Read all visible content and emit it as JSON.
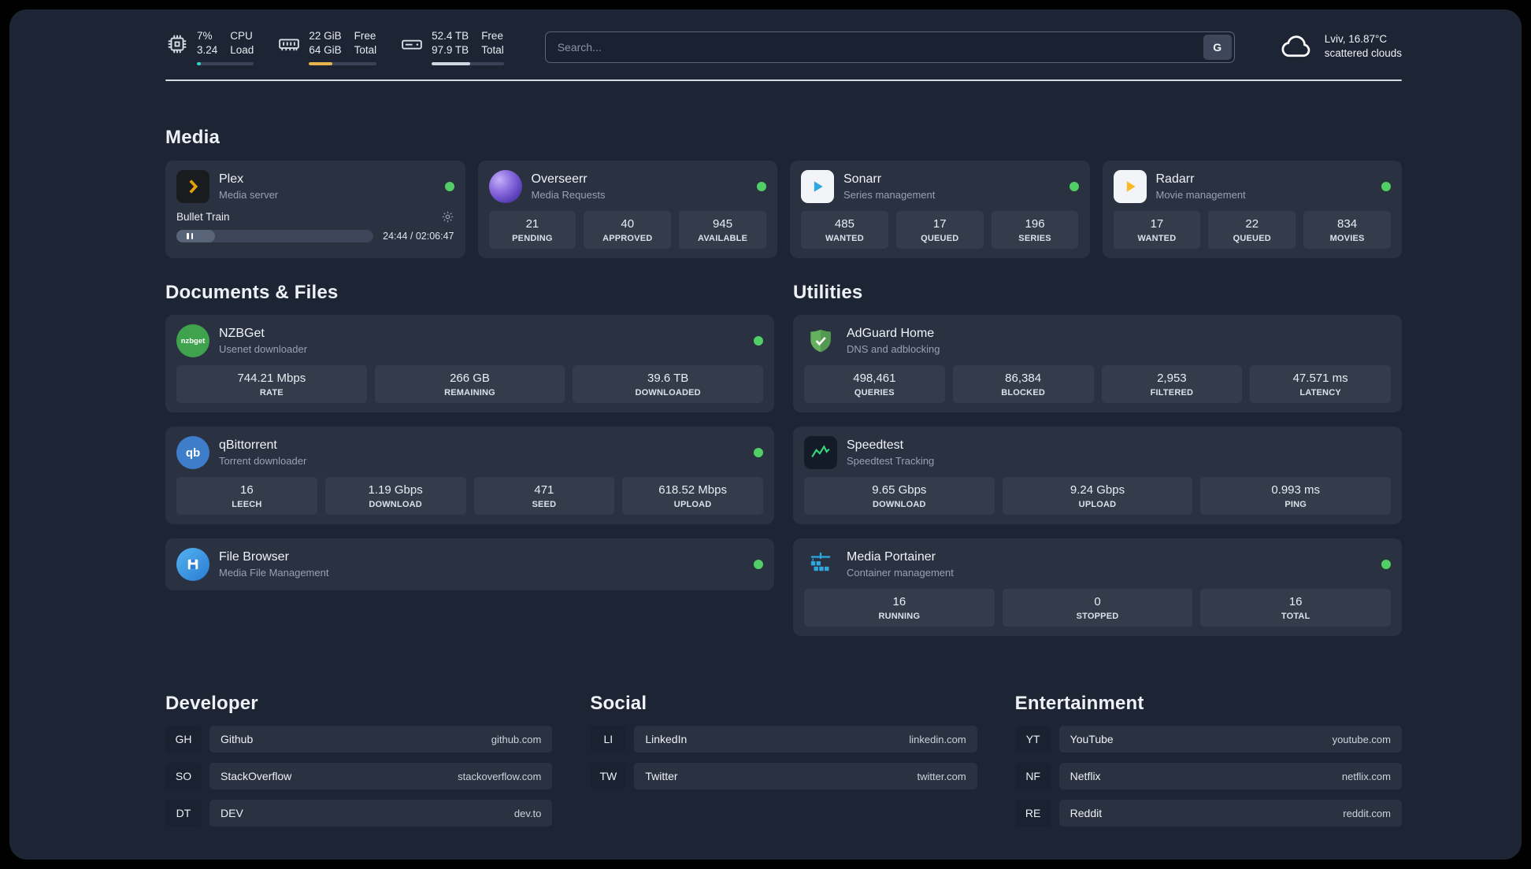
{
  "colors": {
    "status_online": "#51cf66",
    "cpu_fill": "#2fd6c3",
    "ram_fill": "#e8b44c",
    "disk_fill": "#cfd6e0"
  },
  "topbar": {
    "cpu": {
      "value_top": "7%",
      "value_bottom": "3.24",
      "label_top": "CPU",
      "label_bottom": "Load",
      "fill_percent": 7
    },
    "ram": {
      "value_top": "22 GiB",
      "value_bottom": "64 GiB",
      "label_top": "Free",
      "label_bottom": "Total",
      "fill_percent": 34
    },
    "disk": {
      "value_top": "52.4 TB",
      "value_bottom": "97.9 TB",
      "label_top": "Free",
      "label_bottom": "Total",
      "fill_percent": 53
    },
    "search": {
      "placeholder": "Search...",
      "engine_label": "G"
    },
    "weather": {
      "location": "Lviv, 16.87°C",
      "condition": "scattered clouds"
    }
  },
  "sections": {
    "media": {
      "title": "Media",
      "cards": [
        {
          "name": "Plex",
          "desc": "Media server",
          "status": "online",
          "player": {
            "track": "Bullet Train",
            "time": "24:44 / 02:06:47",
            "progress_percent": 19.5
          }
        },
        {
          "name": "Overseerr",
          "desc": "Media Requests",
          "status": "online",
          "stats": [
            {
              "value": "21",
              "label": "PENDING"
            },
            {
              "value": "40",
              "label": "APPROVED"
            },
            {
              "value": "945",
              "label": "AVAILABLE"
            }
          ]
        },
        {
          "name": "Sonarr",
          "desc": "Series management",
          "status": "online",
          "stats": [
            {
              "value": "485",
              "label": "WANTED"
            },
            {
              "value": "17",
              "label": "QUEUED"
            },
            {
              "value": "196",
              "label": "SERIES"
            }
          ]
        },
        {
          "name": "Radarr",
          "desc": "Movie management",
          "status": "online",
          "stats": [
            {
              "value": "17",
              "label": "WANTED"
            },
            {
              "value": "22",
              "label": "QUEUED"
            },
            {
              "value": "834",
              "label": "MOVIES"
            }
          ]
        }
      ]
    },
    "documents": {
      "title": "Documents & Files",
      "cards": [
        {
          "name": "NZBGet",
          "desc": "Usenet downloader",
          "status": "online",
          "icon_text": "nzbget",
          "stats": [
            {
              "value": "744.21 Mbps",
              "label": "RATE"
            },
            {
              "value": "266 GB",
              "label": "REMAINING"
            },
            {
              "value": "39.6 TB",
              "label": "DOWNLOADED"
            }
          ]
        },
        {
          "name": "qBittorrent",
          "desc": "Torrent downloader",
          "status": "online",
          "icon_text": "qb",
          "stats": [
            {
              "value": "16",
              "label": "LEECH"
            },
            {
              "value": "1.19 Gbps",
              "label": "DOWNLOAD"
            },
            {
              "value": "471",
              "label": "SEED"
            },
            {
              "value": "618.52 Mbps",
              "label": "UPLOAD"
            }
          ]
        },
        {
          "name": "File Browser",
          "desc": "Media File Management",
          "status": "online"
        }
      ]
    },
    "utilities": {
      "title": "Utilities",
      "cards": [
        {
          "name": "AdGuard Home",
          "desc": "DNS and adblocking",
          "stats": [
            {
              "value": "498,461",
              "label": "QUERIES"
            },
            {
              "value": "86,384",
              "label": "BLOCKED"
            },
            {
              "value": "2,953",
              "label": "FILTERED"
            },
            {
              "value": "47.571 ms",
              "label": "LATENCY"
            }
          ]
        },
        {
          "name": "Speedtest",
          "desc": "Speedtest Tracking",
          "stats": [
            {
              "value": "9.65 Gbps",
              "label": "DOWNLOAD"
            },
            {
              "value": "9.24 Gbps",
              "label": "UPLOAD"
            },
            {
              "value": "0.993 ms",
              "label": "PING"
            }
          ]
        },
        {
          "name": "Media Portainer",
          "desc": "Container management",
          "status": "online",
          "stats": [
            {
              "value": "16",
              "label": "RUNNING"
            },
            {
              "value": "0",
              "label": "STOPPED"
            },
            {
              "value": "16",
              "label": "TOTAL"
            }
          ]
        }
      ]
    },
    "developer": {
      "title": "Developer",
      "bookmarks": [
        {
          "abbr": "GH",
          "name": "Github",
          "url": "github.com"
        },
        {
          "abbr": "SO",
          "name": "StackOverflow",
          "url": "stackoverflow.com"
        },
        {
          "abbr": "DT",
          "name": "DEV",
          "url": "dev.to"
        }
      ]
    },
    "social": {
      "title": "Social",
      "bookmarks": [
        {
          "abbr": "LI",
          "name": "LinkedIn",
          "url": "linkedin.com"
        },
        {
          "abbr": "TW",
          "name": "Twitter",
          "url": "twitter.com"
        }
      ]
    },
    "entertainment": {
      "title": "Entertainment",
      "bookmarks": [
        {
          "abbr": "YT",
          "name": "YouTube",
          "url": "youtube.com"
        },
        {
          "abbr": "NF",
          "name": "Netflix",
          "url": "netflix.com"
        },
        {
          "abbr": "RE",
          "name": "Reddit",
          "url": "reddit.com"
        }
      ]
    }
  }
}
